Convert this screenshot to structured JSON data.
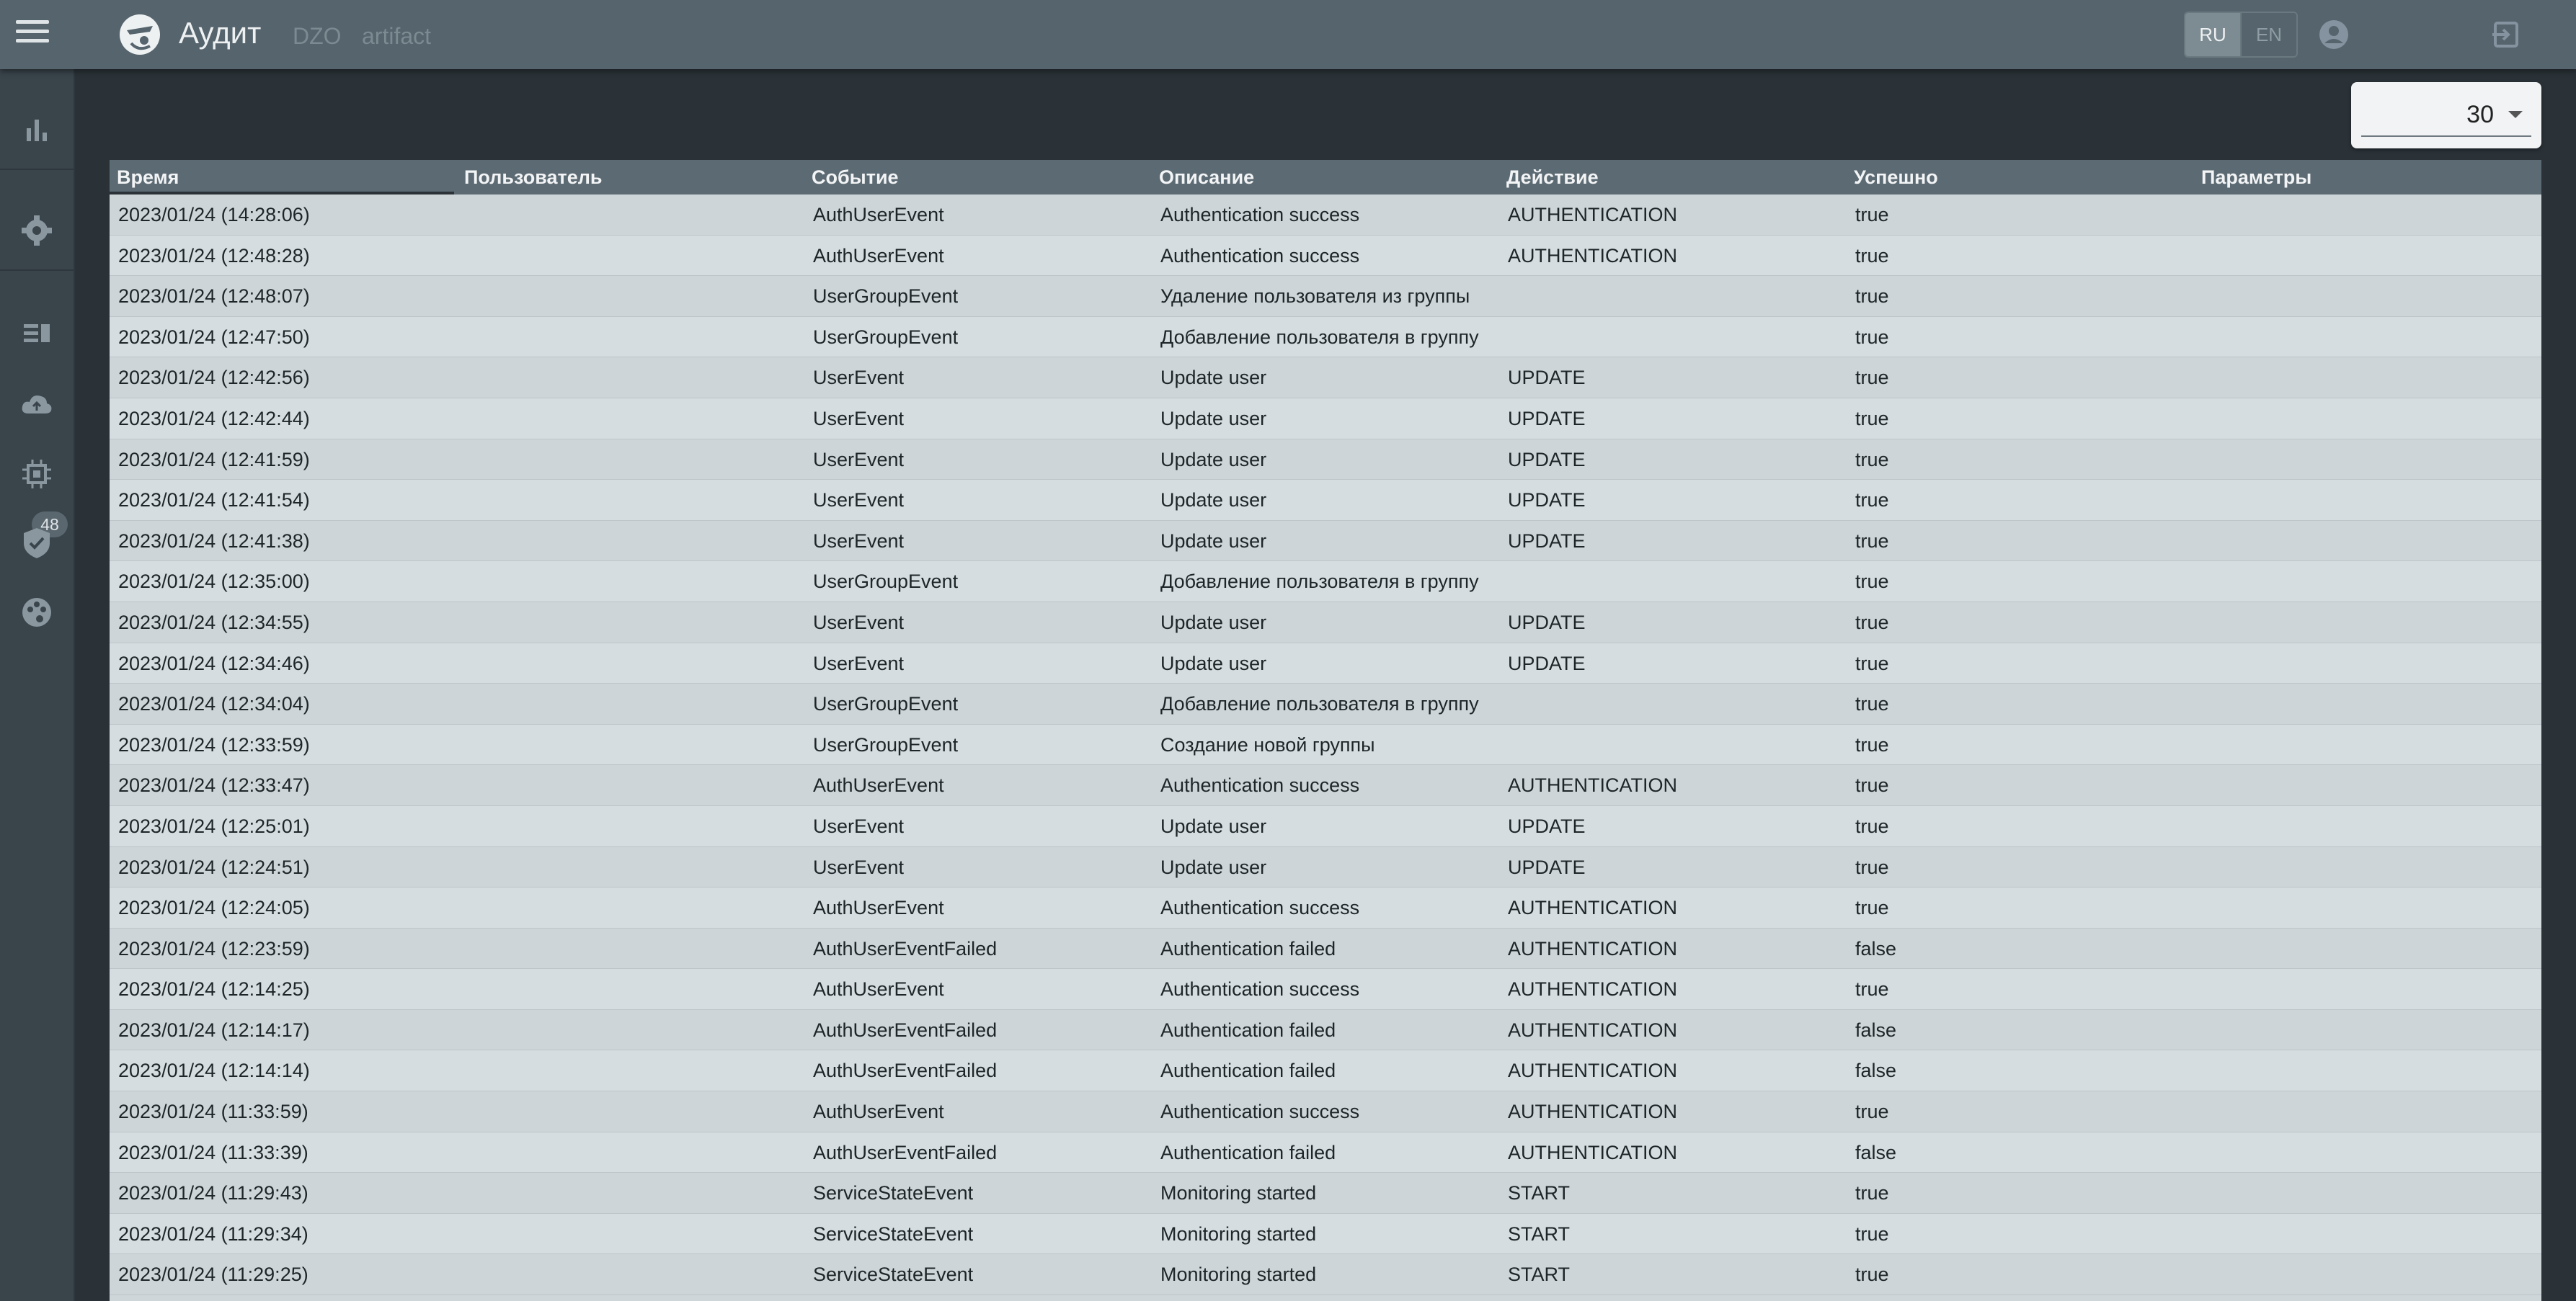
{
  "header": {
    "title": "Аудит",
    "breadcrumb": [
      "DZO",
      "artifact"
    ],
    "languages": {
      "ru": "RU",
      "en": "EN"
    }
  },
  "sidebar": {
    "badge_count": "48",
    "items": [
      "chart-icon",
      "gear-icon",
      "list-icon",
      "cloud-upload-icon",
      "chip-icon",
      "shield-check-icon",
      "palette-icon"
    ]
  },
  "page_size": {
    "value": "30"
  },
  "table": {
    "columns": [
      "Время",
      "Пользователь",
      "Событие",
      "Описание",
      "Действие",
      "Успешно",
      "Параметры"
    ],
    "rows": [
      [
        "2023/01/24 (14:28:06)",
        "",
        "AuthUserEvent",
        "Authentication success",
        "AUTHENTICATION",
        "true",
        ""
      ],
      [
        "2023/01/24 (12:48:28)",
        "",
        "AuthUserEvent",
        "Authentication success",
        "AUTHENTICATION",
        "true",
        ""
      ],
      [
        "2023/01/24 (12:48:07)",
        "",
        "UserGroupEvent",
        "Удаление пользователя из группы",
        "",
        "true",
        ""
      ],
      [
        "2023/01/24 (12:47:50)",
        "",
        "UserGroupEvent",
        "Добавление пользователя в группу",
        "",
        "true",
        ""
      ],
      [
        "2023/01/24 (12:42:56)",
        "",
        "UserEvent",
        "Update user",
        "UPDATE",
        "true",
        ""
      ],
      [
        "2023/01/24 (12:42:44)",
        "",
        "UserEvent",
        "Update user",
        "UPDATE",
        "true",
        ""
      ],
      [
        "2023/01/24 (12:41:59)",
        "",
        "UserEvent",
        "Update user",
        "UPDATE",
        "true",
        ""
      ],
      [
        "2023/01/24 (12:41:54)",
        "",
        "UserEvent",
        "Update user",
        "UPDATE",
        "true",
        ""
      ],
      [
        "2023/01/24 (12:41:38)",
        "",
        "UserEvent",
        "Update user",
        "UPDATE",
        "true",
        ""
      ],
      [
        "2023/01/24 (12:35:00)",
        "",
        "UserGroupEvent",
        "Добавление пользователя в группу",
        "",
        "true",
        ""
      ],
      [
        "2023/01/24 (12:34:55)",
        "",
        "UserEvent",
        "Update user",
        "UPDATE",
        "true",
        ""
      ],
      [
        "2023/01/24 (12:34:46)",
        "",
        "UserEvent",
        "Update user",
        "UPDATE",
        "true",
        ""
      ],
      [
        "2023/01/24 (12:34:04)",
        "",
        "UserGroupEvent",
        "Добавление пользователя в группу",
        "",
        "true",
        ""
      ],
      [
        "2023/01/24 (12:33:59)",
        "",
        "UserGroupEvent",
        "Создание новой группы",
        "",
        "true",
        ""
      ],
      [
        "2023/01/24 (12:33:47)",
        "",
        "AuthUserEvent",
        "Authentication success",
        "AUTHENTICATION",
        "true",
        ""
      ],
      [
        "2023/01/24 (12:25:01)",
        "",
        "UserEvent",
        "Update user",
        "UPDATE",
        "true",
        ""
      ],
      [
        "2023/01/24 (12:24:51)",
        "",
        "UserEvent",
        "Update user",
        "UPDATE",
        "true",
        ""
      ],
      [
        "2023/01/24 (12:24:05)",
        "",
        "AuthUserEvent",
        "Authentication success",
        "AUTHENTICATION",
        "true",
        ""
      ],
      [
        "2023/01/24 (12:23:59)",
        "",
        "AuthUserEventFailed",
        "Authentication failed",
        "AUTHENTICATION",
        "false",
        ""
      ],
      [
        "2023/01/24 (12:14:25)",
        "",
        "AuthUserEvent",
        "Authentication success",
        "AUTHENTICATION",
        "true",
        ""
      ],
      [
        "2023/01/24 (12:14:17)",
        "",
        "AuthUserEventFailed",
        "Authentication failed",
        "AUTHENTICATION",
        "false",
        ""
      ],
      [
        "2023/01/24 (12:14:14)",
        "",
        "AuthUserEventFailed",
        "Authentication failed",
        "AUTHENTICATION",
        "false",
        ""
      ],
      [
        "2023/01/24 (11:33:59)",
        "",
        "AuthUserEvent",
        "Authentication success",
        "AUTHENTICATION",
        "true",
        ""
      ],
      [
        "2023/01/24 (11:33:39)",
        "",
        "AuthUserEventFailed",
        "Authentication failed",
        "AUTHENTICATION",
        "false",
        ""
      ],
      [
        "2023/01/24 (11:29:43)",
        "",
        "ServiceStateEvent",
        "Monitoring started",
        "START",
        "true",
        ""
      ],
      [
        "2023/01/24 (11:29:34)",
        "",
        "ServiceStateEvent",
        "Monitoring started",
        "START",
        "true",
        ""
      ],
      [
        "2023/01/24 (11:29:25)",
        "",
        "ServiceStateEvent",
        "Monitoring started",
        "START",
        "true",
        ""
      ]
    ]
  }
}
